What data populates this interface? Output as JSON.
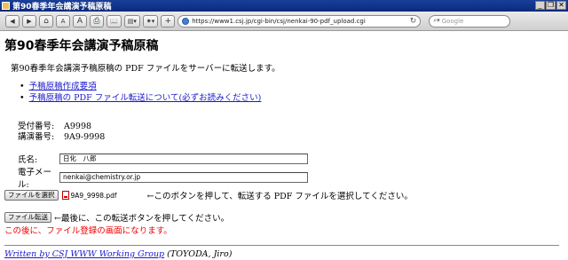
{
  "window": {
    "title": "第90春季年会講演予稿原稿",
    "minimize": "_",
    "restore": "❐",
    "close": "✕"
  },
  "toolbar": {
    "back": "◀",
    "forward": "▶",
    "home": "⌂",
    "text_smaller": "A",
    "text_larger": "A",
    "print": "⎙",
    "bookmarks": "📖",
    "page_menu": "▤▾",
    "settings": "✷▾",
    "add": "+",
    "url": "https://www1.csj.jp/cgi-bin/csj/nenkai-90-pdf_upload.cgi",
    "refresh": "↻",
    "search_placeholder": "Google"
  },
  "page": {
    "heading": "第90春季年会講演予稿原稿",
    "intro": "第90春季年会講演予稿原稿の PDF ファイルをサーバーに転送します。",
    "links": [
      "予稿原稿作成要項",
      "予稿原稿の PDF ファイル転送について(必ずお読みください)"
    ],
    "reception_label": "受付番号:",
    "reception_value": "A9998",
    "lecture_label": "講演番号:",
    "lecture_value": "9A9-9998",
    "name_label": "氏名:",
    "name_value": "日化　八郎",
    "email_label": "電子メール:",
    "email_value": "nenkai@chemistry.or.jp",
    "choose_file_button": "ファイルを選択",
    "file_name": "9A9_9998.pdf",
    "file_note": "←このボタンを押して、転送する PDF ファイルを選択してください。",
    "transfer_button": "ファイル転送",
    "transfer_note": "←最後に、この転送ボタンを押してください。",
    "red_note": "この後に、ファイル登録の画面になります。",
    "footer_link": "Written by CSJ WWW Working Group",
    "footer_author": " (TOYODA, Jiro)"
  }
}
